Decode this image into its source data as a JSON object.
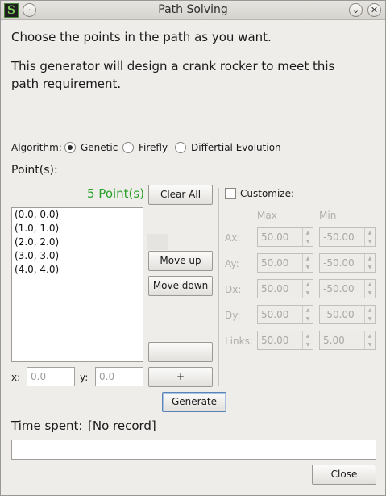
{
  "window": {
    "title": "Path Solving"
  },
  "intro": {
    "line1": "Choose the points in the path as you want.",
    "line2": "This generator will design a crank rocker to meet this path requirement."
  },
  "algorithm": {
    "label": "Algorithm:",
    "options": [
      "Genetic",
      "Firefly",
      "Differtial Evolution"
    ],
    "selected": "Genetic"
  },
  "points": {
    "label": "Point(s):",
    "count": "5 Point(s)",
    "count_color": "#2aa12a",
    "items": [
      "(0.0, 0.0)",
      "(1.0, 1.0)",
      "(2.0, 2.0)",
      "(3.0, 3.0)",
      "(4.0, 4.0)"
    ],
    "clear_all": "Clear All",
    "move_up": "Move up",
    "move_down": "Move down",
    "remove": "-",
    "add": "+",
    "x_label": "x:",
    "y_label": "y:",
    "x_placeholder": "0.0",
    "y_placeholder": "0.0"
  },
  "customize": {
    "label": "Customize:",
    "checked": false,
    "max_header": "Max",
    "min_header": "Min",
    "rows": [
      {
        "label": "Ax:",
        "max": "50.00",
        "min": "-50.00"
      },
      {
        "label": "Ay:",
        "max": "50.00",
        "min": "-50.00"
      },
      {
        "label": "Dx:",
        "max": "50.00",
        "min": "-50.00"
      },
      {
        "label": "Dy:",
        "max": "50.00",
        "min": "-50.00"
      },
      {
        "label": "Links:",
        "max": "50.00",
        "min": "5.00"
      }
    ]
  },
  "actions": {
    "generate": "Generate",
    "close": "Close"
  },
  "time": {
    "label": "Time spent:",
    "value": "[No record]"
  },
  "icons": {
    "app": "app-logo-icon",
    "minimize": "minimize-icon",
    "shade": "chevron-down-icon",
    "close": "close-icon"
  }
}
